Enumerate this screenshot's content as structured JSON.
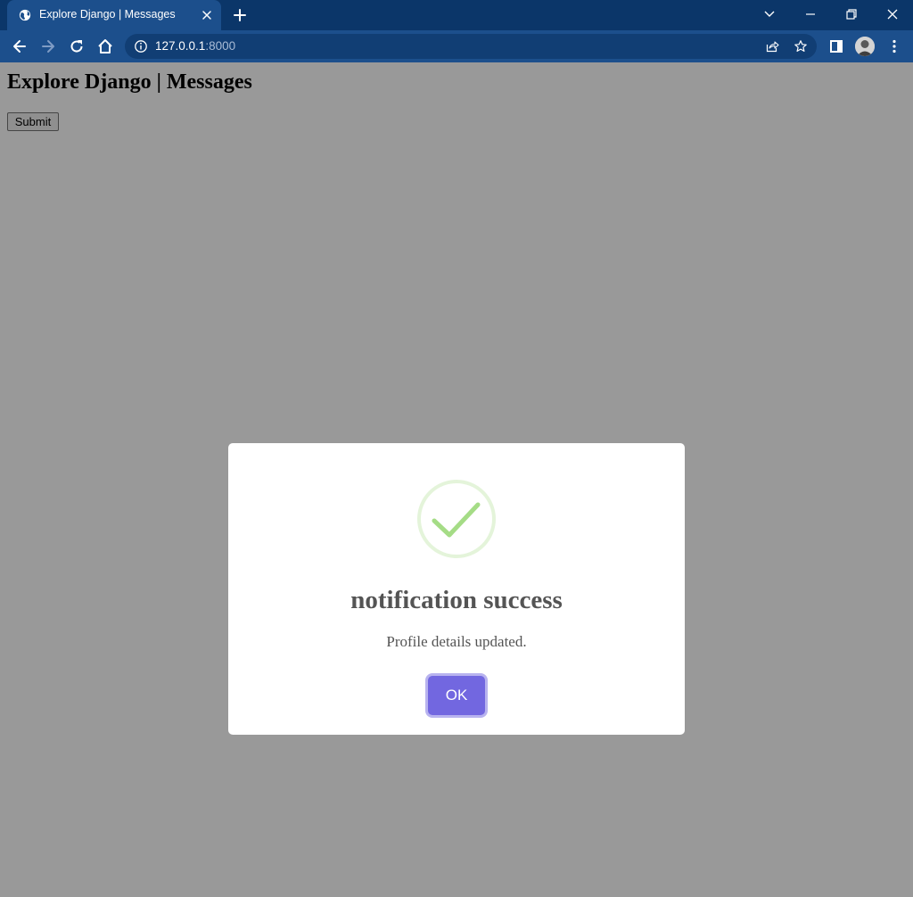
{
  "browser": {
    "tab_title": "Explore Django | Messages",
    "url_host": "127.0.0.1",
    "url_port": ":8000"
  },
  "page": {
    "title": "Explore Django | Messages",
    "submit_label": "Submit"
  },
  "modal": {
    "title": "notification success",
    "message": "Profile details updated.",
    "ok_label": "OK",
    "icon": "success-check-icon"
  },
  "colors": {
    "tabbar_bg": "#0b3669",
    "toolbar_bg": "#1c4f8c",
    "ok_button": "#7267e0",
    "success_check": "#a5dc86",
    "overlay": "rgba(0,0,0,0.4)"
  }
}
